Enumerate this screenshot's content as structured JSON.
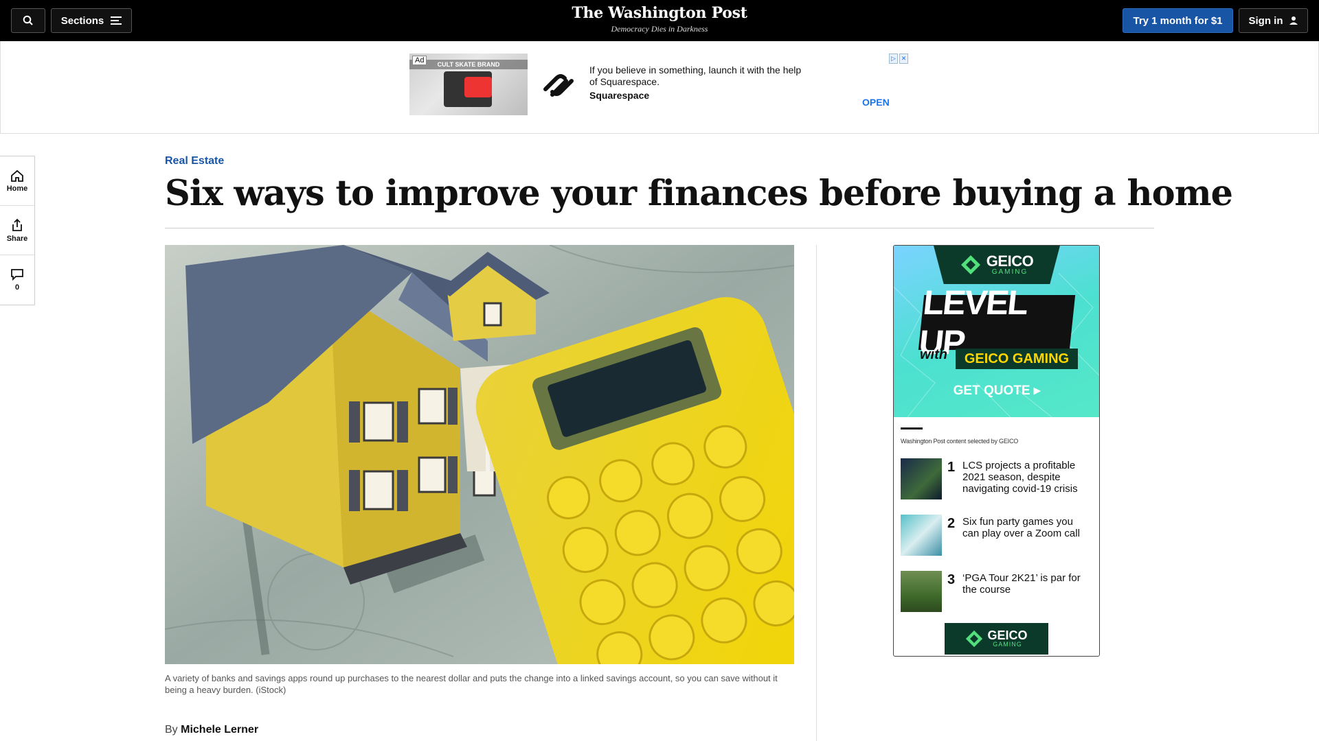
{
  "topbar": {
    "sections_label": "Sections",
    "masthead_name": "The Washington Post",
    "masthead_tagline": "Democracy Dies in Darkness",
    "try_label": "Try 1 month for $1",
    "signin_label": "Sign in"
  },
  "banner_ad": {
    "ad_label": "Ad",
    "thumb_brand": "CULT SKATE BRAND",
    "text": "If you believe in something, launch it with the help of Squarespace.",
    "sponsor": "Squarespace",
    "cta": "OPEN"
  },
  "rail": {
    "home": "Home",
    "share": "Share",
    "comments_count": "0"
  },
  "article": {
    "kicker": "Real Estate",
    "headline": "Six ways to improve your finances before buying a home",
    "caption": "A variety of banks and savings apps round up purchases to the nearest dollar and puts the change into a linked savings account, so you can save without it being a heavy burden. (iStock)",
    "byline_prefix": "By",
    "author": "Michele Lerner"
  },
  "side_ad": {
    "badge_word": "GEICO",
    "badge_sub": "GAMING",
    "headline": "LEVEL UP",
    "with": "with",
    "strip": "GEICO GAMING",
    "cta": "GET QUOTE ▸",
    "label": "Washington Post content selected by GEICO",
    "items": [
      {
        "num": "1",
        "text": "LCS projects a profitable 2021 season, despite navigating covid-19 crisis"
      },
      {
        "num": "2",
        "text": "Six fun party games you can play over a Zoom call"
      },
      {
        "num": "3",
        "text": "‘PGA Tour 2K21’ is par for the course"
      }
    ],
    "footer_word": "GEICO",
    "footer_sub": "GAMING"
  },
  "colors": {
    "brand_blue": "#1955a5",
    "topbar_bg": "#000000",
    "geico_green": "#0b3a2b",
    "geico_yellow": "#ffd500"
  }
}
